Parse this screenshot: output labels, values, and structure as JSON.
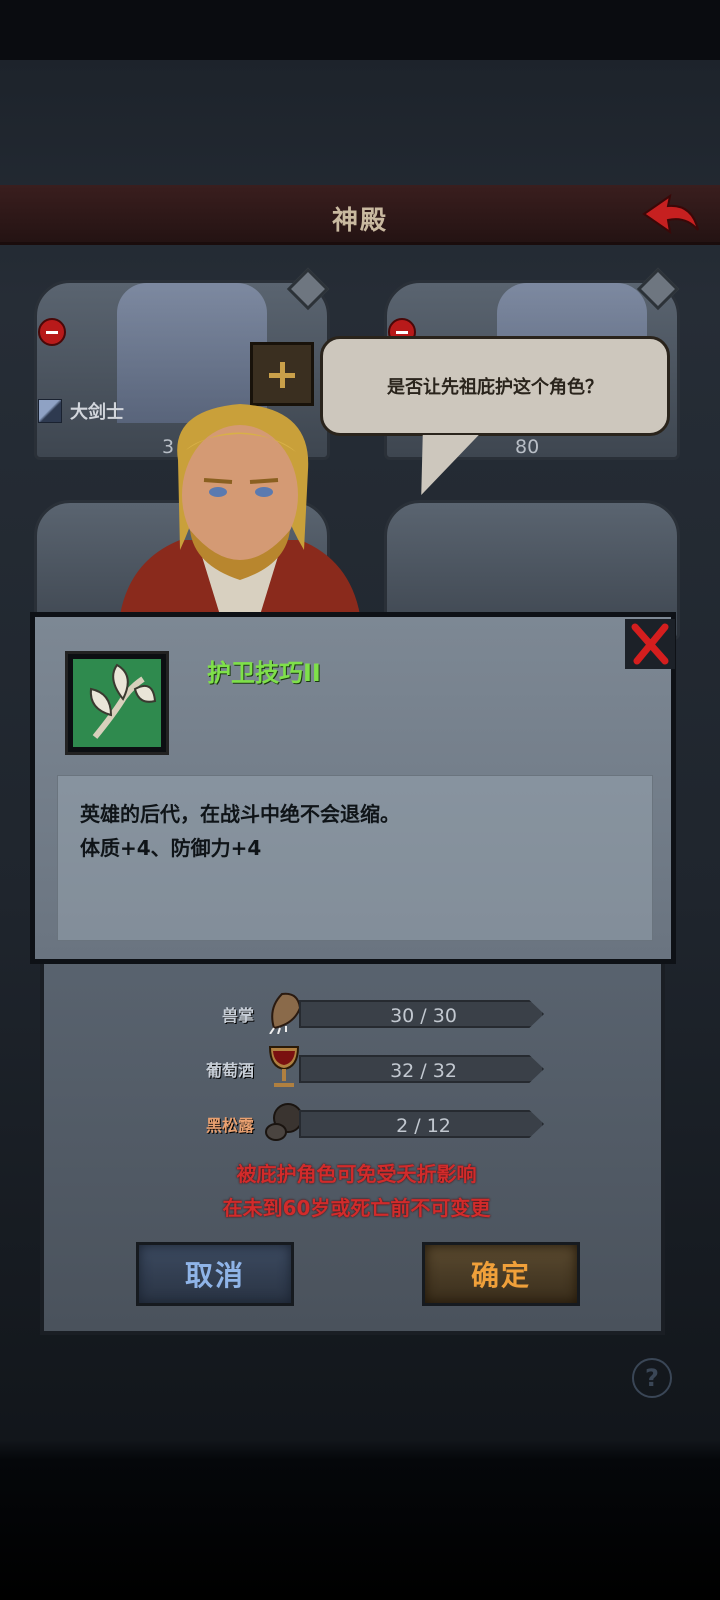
{
  "header": {
    "title": "神殿"
  },
  "slots": {
    "slot1": {
      "class_label": "大剑士",
      "age": "3"
    },
    "slot2": {
      "age": "80"
    }
  },
  "bubble": {
    "text": "是否让先祖庇护这个角色？"
  },
  "tooltip": {
    "skill_name": "护卫技巧II",
    "description_line1": "英雄的后代，在战斗中绝不会退缩。",
    "description_line2": "体质+4、防御力+4"
  },
  "resources": [
    {
      "label": "兽掌",
      "value": "30 / 30",
      "icon": "paw-icon"
    },
    {
      "label": "葡萄酒",
      "value": "32 / 32",
      "icon": "goblet-icon"
    },
    {
      "label": "黑松露",
      "value": "2 / 12",
      "icon": "truffle-icon"
    }
  ],
  "warning": {
    "line1": "被庇护角色可免受夭折影响",
    "line2": "在未到60岁或死亡前不可变更"
  },
  "buttons": {
    "cancel": "取消",
    "confirm": "确定"
  },
  "help": {
    "label": "?"
  },
  "colors": {
    "skill_title": "#7fe04a",
    "warning": "#d12b2b",
    "confirm": "#f0a03a",
    "cancel": "#8fb4e8"
  }
}
